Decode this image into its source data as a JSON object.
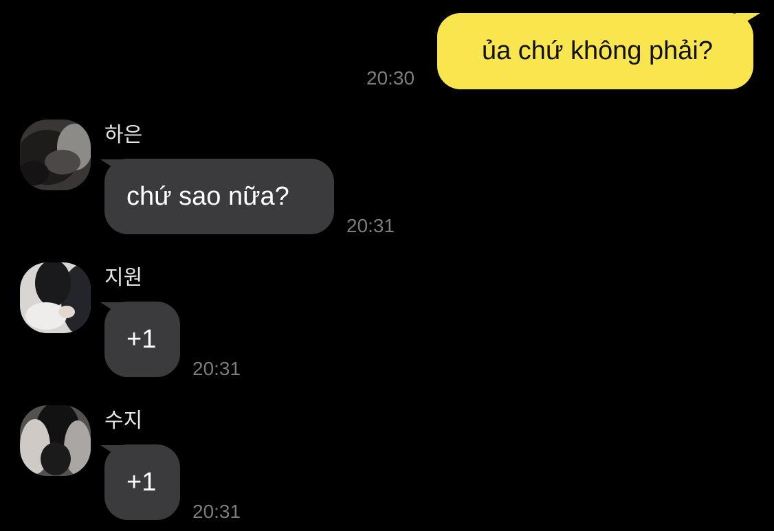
{
  "conversation": {
    "outgoing": {
      "text": "ủa chứ không phải?",
      "time": "20:30",
      "bubble_color": "#f9e64e"
    },
    "incoming": [
      {
        "sender": "하은",
        "text": "chứ sao nữa?",
        "time": "20:31",
        "avatar": "profile-photo"
      },
      {
        "sender": "지원",
        "text": "+1",
        "time": "20:31",
        "avatar": "profile-photo"
      },
      {
        "sender": "수지",
        "text": "+1",
        "time": "20:31",
        "avatar": "profile-photo"
      }
    ],
    "incoming_bubble_color": "#3b3b3d",
    "background_color": "#000000"
  }
}
